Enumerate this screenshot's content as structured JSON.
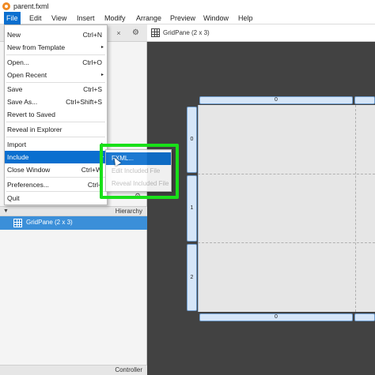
{
  "window": {
    "title": "parent.fxml"
  },
  "menubar": [
    {
      "label": "File"
    },
    {
      "label": "Edit"
    },
    {
      "label": "View"
    },
    {
      "label": "Insert"
    },
    {
      "label": "Modify"
    },
    {
      "label": "Arrange"
    },
    {
      "label": "Preview"
    },
    {
      "label": "Window"
    },
    {
      "label": "Help"
    }
  ],
  "file_menu": {
    "items": [
      {
        "label": "New",
        "shortcut": "Ctrl+N"
      },
      {
        "label": "New from Template",
        "shortcut": "▸"
      },
      {
        "label": "Open...",
        "shortcut": "Ctrl+O"
      },
      {
        "label": "Open Recent",
        "shortcut": "▸"
      },
      {
        "label": "Save",
        "shortcut": "Ctrl+S"
      },
      {
        "label": "Save As...",
        "shortcut": "Ctrl+Shift+S"
      },
      {
        "label": "Revert to Saved",
        "shortcut": ""
      },
      {
        "label": "Reveal in Explorer",
        "shortcut": ""
      },
      {
        "label": "Import",
        "shortcut": "▸"
      },
      {
        "label": "Include",
        "shortcut": "▸"
      },
      {
        "label": "Close Window",
        "shortcut": "Ctrl+W"
      },
      {
        "label": "Preferences...",
        "shortcut": "Ctrl+"
      },
      {
        "label": "Quit",
        "shortcut": ""
      }
    ]
  },
  "include_submenu": {
    "items": [
      {
        "label": "FXML..."
      },
      {
        "label": "Edit Included File"
      },
      {
        "label": "Reveal Included File"
      }
    ]
  },
  "left_panel": {
    "close_glyph": "×",
    "gear_glyph": "⚙",
    "hierarchy_label": "Hierarchy",
    "tree_item": "GridPane (2 x 3)",
    "controller_label": "Controller"
  },
  "content": {
    "header_title": "GridPane (2 x 3)",
    "column_labels": [
      "0"
    ],
    "row_labels": [
      "0",
      "1",
      "2"
    ]
  },
  "colors": {
    "selection_blue": "#0a6fcf",
    "highlight_green": "#19e019",
    "canvas_dark": "#424242"
  }
}
